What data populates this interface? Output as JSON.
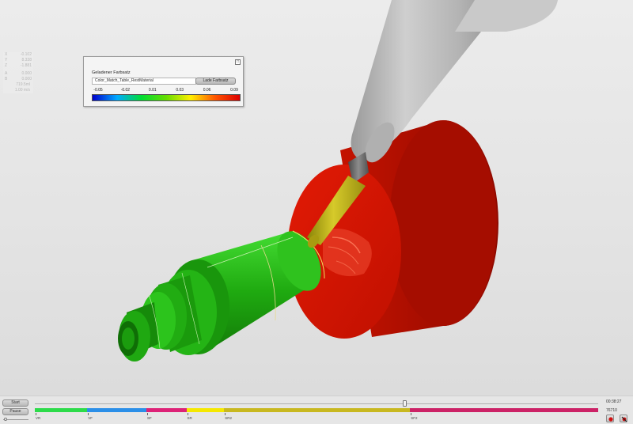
{
  "readout": {
    "x": {
      "label": "X",
      "value": "-0.102"
    },
    "y": {
      "label": "Y",
      "value": "8.338"
    },
    "z": {
      "label": "Z",
      "value": "-1.881"
    },
    "a": {
      "label": "A",
      "value": "0.000"
    },
    "b": {
      "label": "B",
      "value": "0.000"
    },
    "speed1": "719.5ml",
    "speed2": "1.00 m/s"
  },
  "color_panel": {
    "title": "Geladener Farbsatz",
    "table_name": "Color_Match_Table_RestMaterial",
    "load_button": "Lade Farbsatz",
    "close_glyph": "□",
    "scale_labels": [
      "-0.05",
      "-0.02",
      "0.01",
      "0.03",
      "0.06",
      "0.09"
    ],
    "scale_colors": [
      "#0000cc",
      "#00aaff",
      "#00dd33",
      "#66dd00",
      "#ffee00",
      "#ff5500",
      "#dd0000"
    ]
  },
  "controls": {
    "start_label": "Start",
    "pause_label": "Pause",
    "speed_fraction": 0.05,
    "timeline_fraction": 0.656,
    "time": "00:38:27",
    "count": "76710",
    "record_icon": "record-icon",
    "mute_icon": "mute-icon",
    "operations": [
      {
        "label": "VR",
        "start": 0.0,
        "end": 0.093,
        "color": "#2ddb4a"
      },
      {
        "label": "VF",
        "start": 0.093,
        "end": 0.198,
        "color": "#2b8fe8"
      },
      {
        "label": "SF",
        "start": 0.198,
        "end": 0.269,
        "color": "#dd2277"
      },
      {
        "label": "SR",
        "start": 0.269,
        "end": 0.336,
        "color": "#f5e800"
      },
      {
        "label": "SR2",
        "start": 0.336,
        "end": 0.666,
        "color": "#c8b820"
      },
      {
        "label": "SF2",
        "start": 0.666,
        "end": 1.0,
        "color": "#cc2266"
      }
    ]
  },
  "scene": {
    "stock_color": "#cc1100",
    "part_color": "#1faa10",
    "holder_color": "#b8b8b8",
    "tool_color": "#bdb010"
  }
}
